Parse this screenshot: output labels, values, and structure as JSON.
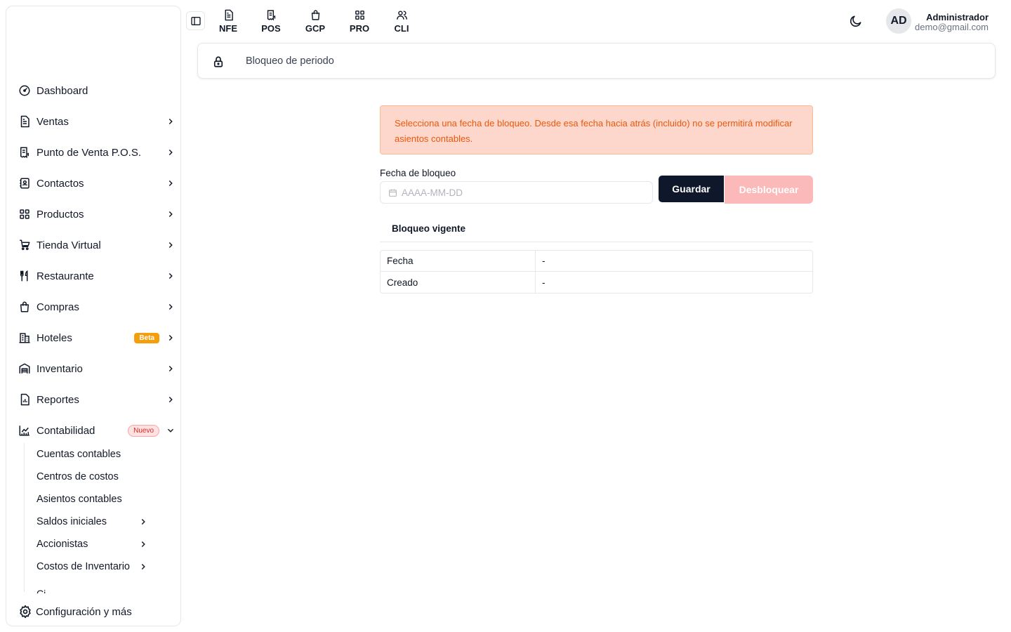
{
  "sidebar": {
    "items": [
      {
        "label": "Dashboard"
      },
      {
        "label": "Ventas"
      },
      {
        "label": "Punto de Venta P.O.S."
      },
      {
        "label": "Contactos"
      },
      {
        "label": "Productos"
      },
      {
        "label": "Tienda Virtual"
      },
      {
        "label": "Restaurante"
      },
      {
        "label": "Compras"
      },
      {
        "label": "Hoteles",
        "badge": "Beta"
      },
      {
        "label": "Inventario"
      },
      {
        "label": "Reportes"
      },
      {
        "label": "Contabilidad",
        "badge": "Nuevo"
      }
    ],
    "sub_items": [
      {
        "label": "Cuentas contables"
      },
      {
        "label": "Centros de costos"
      },
      {
        "label": "Asientos contables"
      },
      {
        "label": "Saldos iniciales"
      },
      {
        "label": "Accionistas"
      },
      {
        "label": "Costos de Inventario"
      }
    ],
    "sub_partial": "Ci",
    "config_label": "Configuración y más"
  },
  "topbar": {
    "apps": [
      {
        "label": "NFE",
        "icon": "file-text-icon"
      },
      {
        "label": "POS",
        "icon": "receipt-icon"
      },
      {
        "label": "GCP",
        "icon": "shopping-bag-icon"
      },
      {
        "label": "PRO",
        "icon": "grid-icon"
      },
      {
        "label": "CLI",
        "icon": "users-icon"
      }
    ],
    "theme_icon": "moon-icon",
    "user": {
      "initials": "AD",
      "name": "Administrador",
      "email": "demo@gmail.com"
    }
  },
  "breadcrumb": {
    "title": "Bloqueo de periodo",
    "icon": "lock-icon"
  },
  "main": {
    "alert": "Selecciona una fecha de bloqueo. Desde esa fecha hacia atrás (incluido) no se permitirá modificar asientos contables.",
    "date_label": "Fecha de bloqueo",
    "date_placeholder": "AAAA-MM-DD",
    "save_label": "Guardar",
    "unlock_label": "Desbloquear",
    "section_title": "Bloqueo vigente",
    "rows": [
      {
        "key": "Fecha",
        "value": "-"
      },
      {
        "key": "Creado",
        "value": "-"
      }
    ]
  },
  "colors": {
    "primary_button": "#0f172a",
    "unlock_button": "#fbb9b9",
    "alert_bg": "#fed7cc",
    "alert_text": "#ea580c",
    "beta_badge": "#f59e0b",
    "new_badge_text": "#dc2626"
  }
}
